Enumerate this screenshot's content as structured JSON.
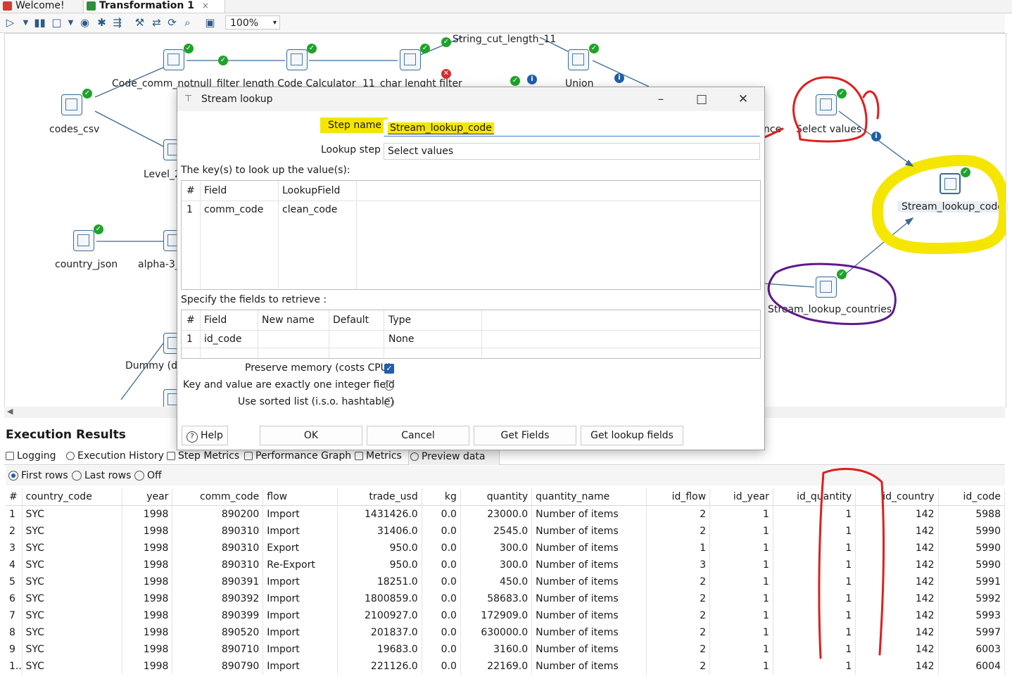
{
  "tabs": [
    {
      "label": "Welcome!"
    },
    {
      "label": "Transformation 1",
      "close": "×"
    }
  ],
  "toolbar": {
    "zoom": "100%"
  },
  "canvas": {
    "steps": {
      "codes_csv": "codes_csv",
      "code_comm_notnull": "Code_comm_notnull_filter",
      "length_code_calc": "length Code Calculator",
      "char_filter": "11_char lenght filter",
      "string_cut": "String_cut_length_11",
      "union": "Union",
      "level_2": "Level_2",
      "select_values": "Select values",
      "stream_lookup_code": "Stream_lookup_code",
      "country_json": "country_json",
      "alpha_3": "alpha-3_",
      "stream_lookup_countries": "Stream_lookup_countries",
      "dummy": "Dummy (de",
      "partial_nce": "nce"
    }
  },
  "dialog": {
    "title": "Stream lookup",
    "step_name_label": "Step name",
    "step_name_value": "Stream_lookup_code",
    "lookup_step_label": "Lookup step",
    "lookup_step_value": "Select values",
    "keys_label": "The key(s) to look up the value(s):",
    "keys_table": {
      "headers": [
        "#",
        "Field",
        "LookupField"
      ],
      "rows": [
        [
          "1",
          "comm_code",
          "clean_code"
        ]
      ]
    },
    "retrieve_label": "Specify the fields to retrieve :",
    "retrieve_table": {
      "headers": [
        "#",
        "Field",
        "New name",
        "Default",
        "Type"
      ],
      "rows": [
        [
          "1",
          "id_code",
          "",
          "",
          "None"
        ]
      ]
    },
    "options": {
      "preserve_memory": "Preserve memory (costs CPU)",
      "integer_field": "Key and value are exactly one integer field",
      "sorted_list": "Use sorted list (i.s.o. hashtable)"
    },
    "buttons": {
      "help": "Help",
      "ok": "OK",
      "cancel": "Cancel",
      "get_fields": "Get Fields",
      "get_lookup_fields": "Get lookup fields"
    }
  },
  "execution": {
    "title": "Execution Results",
    "tabs": [
      "Logging",
      "Execution History",
      "Step Metrics",
      "Performance Graph",
      "Metrics",
      "Preview data"
    ],
    "radio": {
      "first": "First rows",
      "last": "Last rows",
      "off": "Off"
    },
    "columns": [
      "#",
      "country_code",
      "year",
      "comm_code",
      "flow",
      "trade_usd",
      "kg",
      "quantity",
      "quantity_name",
      "id_flow",
      "id_year",
      "id_quantity",
      "id_country",
      "id_code"
    ],
    "rows": [
      [
        "1",
        "SYC",
        "1998",
        "890200",
        "Import",
        "1431426.0",
        "0.0",
        "23000.0",
        "Number of items",
        "2",
        "1",
        "1",
        "142",
        "5988"
      ],
      [
        "2",
        "SYC",
        "1998",
        "890310",
        "Import",
        "31406.0",
        "0.0",
        "2545.0",
        "Number of items",
        "2",
        "1",
        "1",
        "142",
        "5990"
      ],
      [
        "3",
        "SYC",
        "1998",
        "890310",
        "Export",
        "950.0",
        "0.0",
        "300.0",
        "Number of items",
        "1",
        "1",
        "1",
        "142",
        "5990"
      ],
      [
        "4",
        "SYC",
        "1998",
        "890310",
        "Re-Export",
        "950.0",
        "0.0",
        "300.0",
        "Number of items",
        "3",
        "1",
        "1",
        "142",
        "5990"
      ],
      [
        "5",
        "SYC",
        "1998",
        "890391",
        "Import",
        "18251.0",
        "0.0",
        "450.0",
        "Number of items",
        "2",
        "1",
        "1",
        "142",
        "5991"
      ],
      [
        "6",
        "SYC",
        "1998",
        "890392",
        "Import",
        "1800859.0",
        "0.0",
        "58683.0",
        "Number of items",
        "2",
        "1",
        "1",
        "142",
        "5992"
      ],
      [
        "7",
        "SYC",
        "1998",
        "890399",
        "Import",
        "2100927.0",
        "0.0",
        "172909.0",
        "Number of items",
        "2",
        "1",
        "1",
        "142",
        "5993"
      ],
      [
        "8",
        "SYC",
        "1998",
        "890520",
        "Import",
        "201837.0",
        "0.0",
        "630000.0",
        "Number of items",
        "2",
        "1",
        "1",
        "142",
        "5997"
      ],
      [
        "9",
        "SYC",
        "1998",
        "890710",
        "Import",
        "19683.0",
        "0.0",
        "3160.0",
        "Number of items",
        "2",
        "1",
        "1",
        "142",
        "6003"
      ],
      [
        "1..",
        "SYC",
        "1998",
        "890790",
        "Import",
        "221126.0",
        "0.0",
        "22169.0",
        "Number of items",
        "2",
        "1",
        "1",
        "142",
        "6004"
      ]
    ]
  },
  "colors": {
    "accent": "#1e5fae",
    "ok": "#1fa32a",
    "annot_red": "#e01e1e",
    "annot_purple": "#5e1a8a",
    "annot_yellow": "#f5e600"
  }
}
